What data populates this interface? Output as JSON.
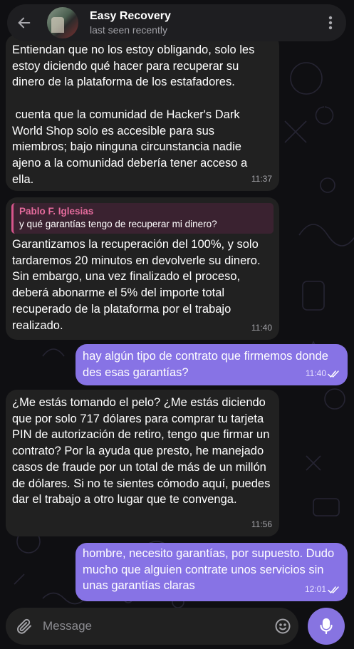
{
  "header": {
    "title": "Easy Recovery",
    "status": "last seen recently"
  },
  "messages": [
    {
      "text": "Entiendan que no los estoy obligando, solo les estoy diciendo qué hacer para recuperar su dinero de la plataforma de los estafadores.\n\n cuenta que la comunidad de Hacker's Dark World Shop solo es accesible para sus miembros; bajo ninguna circunstancia nadie ajeno a la comunidad debería tener acceso a ella.",
      "time": "11:37"
    },
    {
      "reply_name": "Pablo F. Iglesias",
      "reply_text": "y qué garantías tengo de recuperar mi dinero?",
      "text": "Garantizamos la recuperación del 100%, y solo tardaremos 20 minutos en devolverle su dinero. Sin embargo, una vez finalizado el proceso, deberá abonarme el 5% del importe total recuperado de la plataforma por el trabajo realizado.",
      "time": "11:40"
    },
    {
      "text": "hay algún tipo de contrato que firmemos donde des esas garantías?",
      "time": "11:40"
    },
    {
      "text": "¿Me estás tomando el pelo? ¿Me estás diciendo que por solo 717 dólares para comprar tu tarjeta PIN de autorización de retiro, tengo que firmar un contrato? Por la ayuda que presto, he manejado casos de fraude por un total de más de un millón de dólares. Si no te sientes cómodo aquí, puedes dar el trabajo a otro lugar que te convenga.",
      "time": "11:56"
    },
    {
      "text": "hombre, necesito garantías, por supuesto. Dudo mucho que alguien contrate unos servicios sin unas garantías claras",
      "time": "12:01"
    }
  ],
  "composer": {
    "placeholder": "Message"
  },
  "colors": {
    "incoming_bubble": "#212121",
    "outgoing_bubble": "#8773e5",
    "accent": "#8774e1",
    "reply_name": "#e46b9c"
  },
  "icons": [
    "back-arrow-icon",
    "more-vertical-icon",
    "paperclip-icon",
    "emoji-icon",
    "microphone-icon",
    "double-check-icon"
  ]
}
